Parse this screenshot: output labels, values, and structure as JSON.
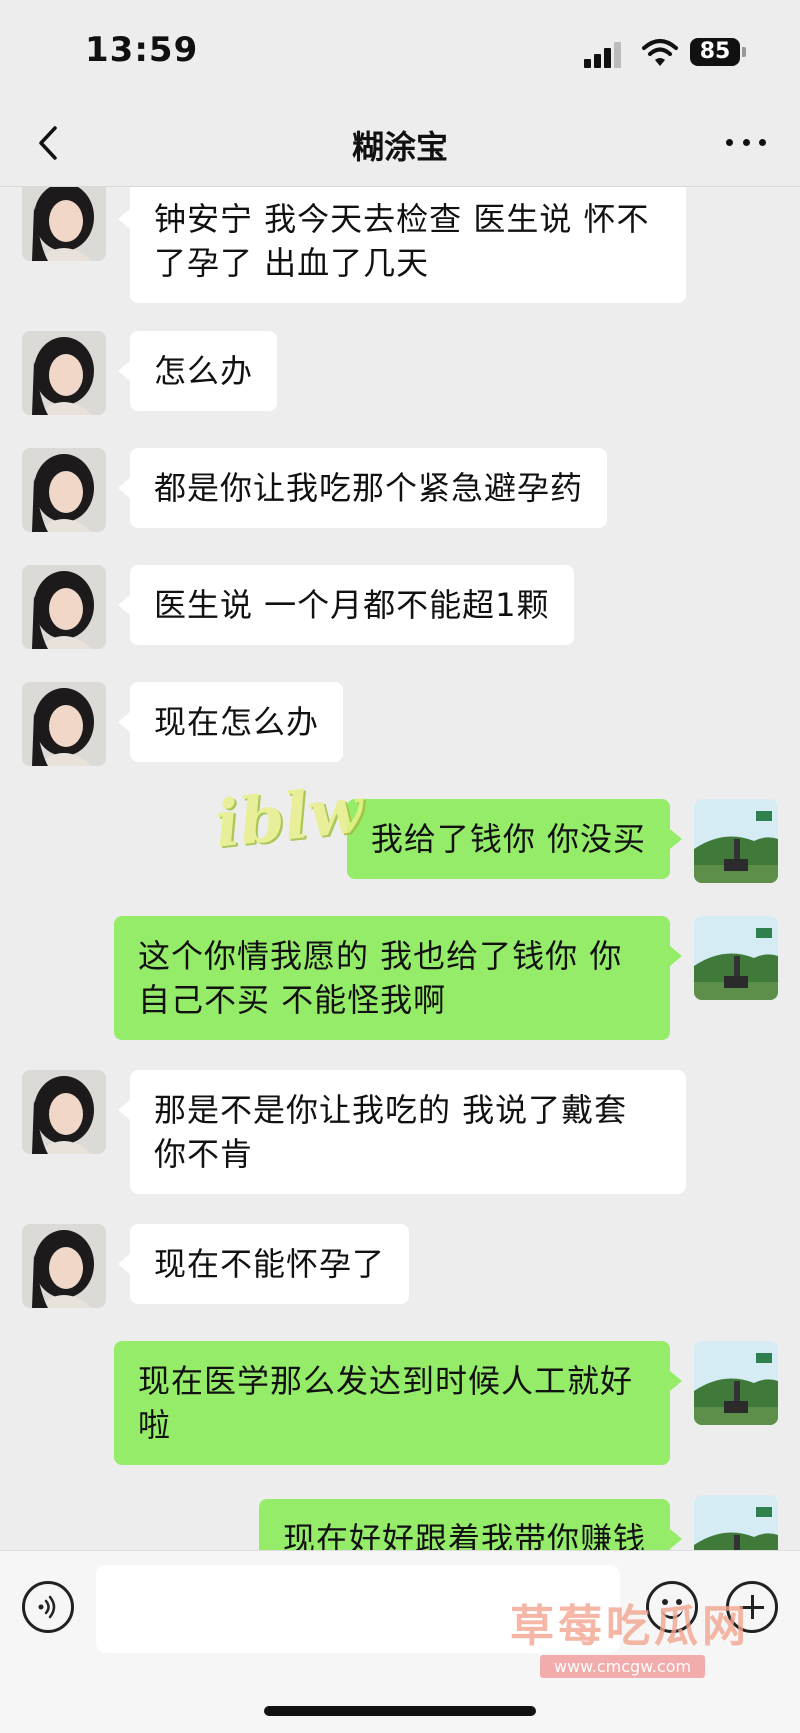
{
  "status_bar": {
    "time": "13:59",
    "battery": "85"
  },
  "header": {
    "title": "糊涂宝"
  },
  "messages": [
    {
      "side": "left",
      "text": "钟安宁 我今天去检查 医生说 怀不了孕了 出血了几天"
    },
    {
      "side": "left",
      "text": "怎么办"
    },
    {
      "side": "left",
      "text": "都是你让我吃那个紧急避孕药"
    },
    {
      "side": "left",
      "text": "医生说 一个月都不能超1颗"
    },
    {
      "side": "left",
      "text": "现在怎么办"
    },
    {
      "side": "right",
      "text": "我给了钱你 你没买"
    },
    {
      "side": "right",
      "text": "这个你情我愿的 我也给了钱你 你自己不买 不能怪我啊"
    },
    {
      "side": "left",
      "text": "那是不是你让我吃的 我说了戴套 你不肯"
    },
    {
      "side": "left",
      "text": "现在不能怀孕了"
    },
    {
      "side": "right",
      "text": "现在医学那么发达到时候人工就好啦"
    },
    {
      "side": "right",
      "text": "现在好好跟着我带你赚钱"
    }
  ],
  "watermarks": {
    "overlay": "iblw",
    "site": "草莓吃瓜网",
    "url": "www.cmcgw.com"
  },
  "icons": {
    "back": "chevron-left-icon",
    "more": "more-dots-icon",
    "voice": "voice-icon",
    "emoji": "emoji-icon",
    "plus": "plus-icon"
  },
  "colors": {
    "background": "#ededed",
    "sent_bubble": "#95ec69",
    "received_bubble": "#ffffff"
  }
}
